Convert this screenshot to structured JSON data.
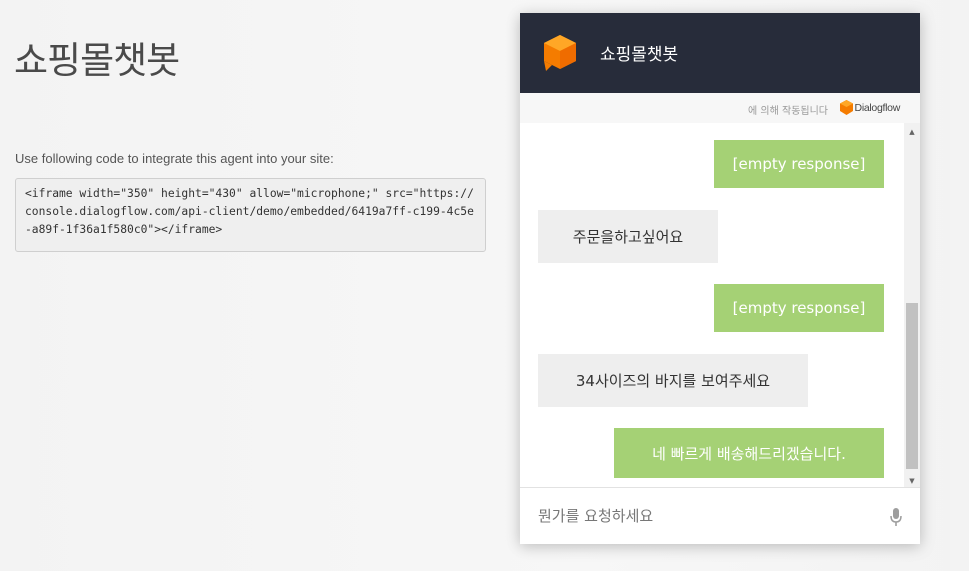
{
  "page": {
    "title": "쇼핑몰챗봇",
    "integrate_label": "Use following code to integrate this agent into your site:",
    "embed_code": "<iframe width=\"350\" height=\"430\" allow=\"microphone;\" src=\"https://console.dialogflow.com/api-client/demo/embedded/6419a7ff-c199-4c5e-a89f-1f36a1f580c0\"></iframe>"
  },
  "chat": {
    "title": "쇼핑몰챗봇",
    "powered_by": "에 의해 작동됩니다",
    "brand": "Dialogflow",
    "messages": [
      {
        "from": "user",
        "text": "[empty response]"
      },
      {
        "from": "bot",
        "text": "주문을하고싶어요"
      },
      {
        "from": "user",
        "text": "[empty response]"
      },
      {
        "from": "bot",
        "text": "34사이즈의 바지를 보여주세요"
      },
      {
        "from": "user",
        "text": "네 빠르게 배송해드리겠습니다."
      }
    ],
    "input_placeholder": "뭔가를 요청하세요"
  },
  "colors": {
    "header_bg": "#272c3a",
    "user_bubble": "#a5d175",
    "bot_bubble": "#eeeeee",
    "brand_orange": "#f57c00"
  },
  "icons": [
    "agent-cube-icon",
    "dialogflow-logo-icon",
    "scroll-up-icon",
    "scroll-down-icon",
    "microphone-icon"
  ]
}
